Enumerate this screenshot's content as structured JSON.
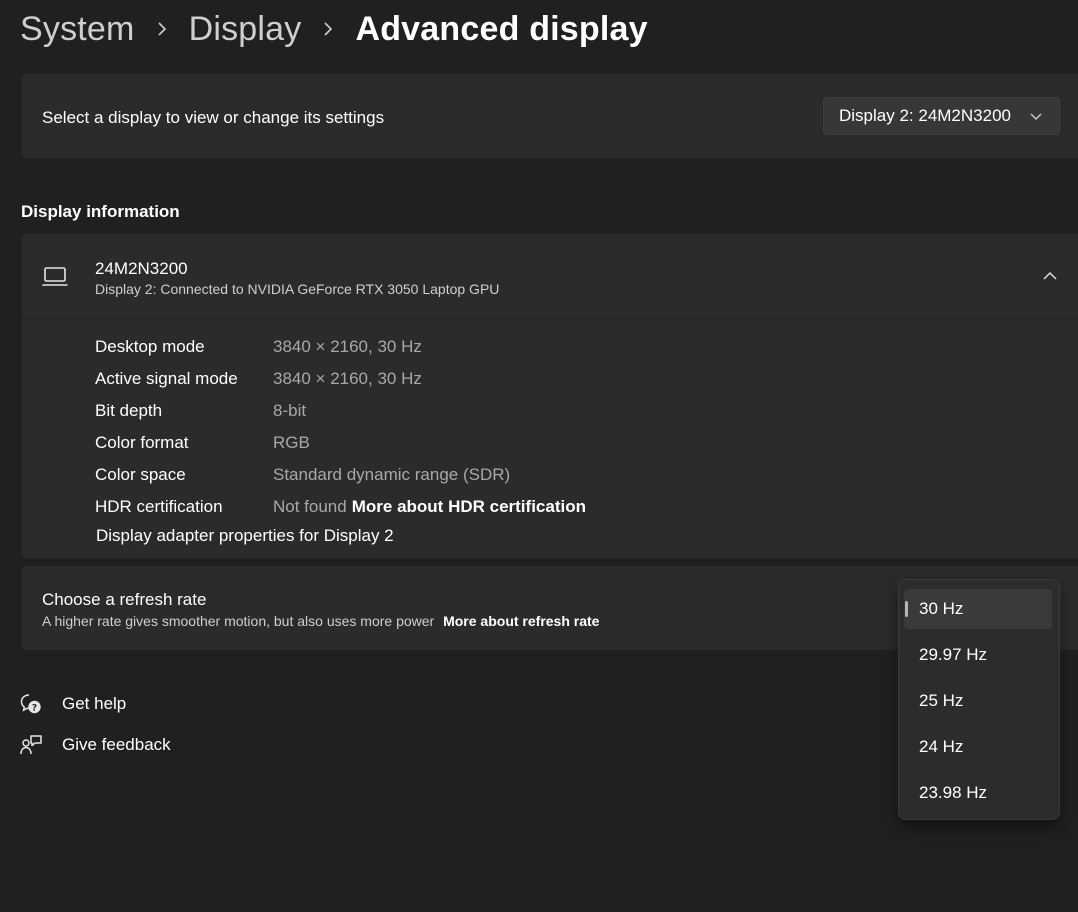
{
  "breadcrumb": {
    "items": [
      "System",
      "Display",
      "Advanced display"
    ]
  },
  "select_display": {
    "label": "Select a display to view or change its settings",
    "selected": "Display 2: 24M2N3200"
  },
  "display_info": {
    "section_title": "Display information",
    "name": "24M2N3200",
    "subtitle": "Display 2: Connected to NVIDIA GeForce RTX 3050 Laptop GPU",
    "rows": [
      {
        "key": "Desktop mode",
        "value": "3840 × 2160, 30 Hz"
      },
      {
        "key": "Active signal mode",
        "value": "3840 × 2160, 30 Hz"
      },
      {
        "key": "Bit depth",
        "value": "8-bit"
      },
      {
        "key": "Color format",
        "value": "RGB"
      },
      {
        "key": "Color space",
        "value": "Standard dynamic range (SDR)"
      },
      {
        "key": "HDR certification",
        "value": "Not found",
        "link": "More about HDR certification"
      }
    ],
    "adapter_link": "Display adapter properties for Display 2"
  },
  "refresh_rate": {
    "title": "Choose a refresh rate",
    "description": "A higher rate gives smoother motion, but also uses more power",
    "link": "More about refresh rate",
    "options": [
      "30 Hz",
      "29.97 Hz",
      "25 Hz",
      "24 Hz",
      "23.98 Hz"
    ],
    "selected_index": 0
  },
  "help": {
    "get_help": "Get help",
    "give_feedback": "Give feedback"
  },
  "colors": {
    "background": "#202020",
    "card": "#2b2b2b",
    "accent_pill": "#a7b8c2"
  }
}
